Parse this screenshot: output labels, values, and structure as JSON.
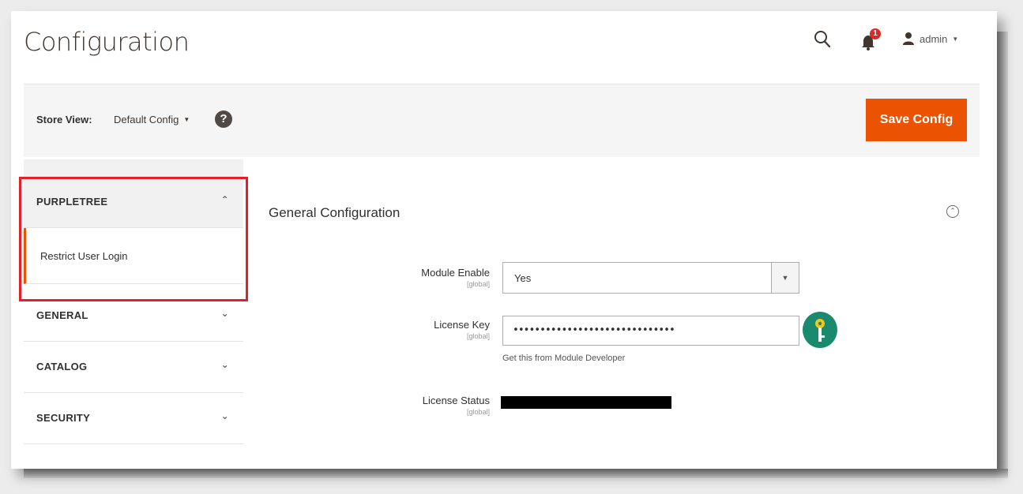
{
  "header": {
    "title": "Configuration",
    "notification_count": "1",
    "user_name": "admin"
  },
  "store_bar": {
    "label": "Store View:",
    "selected": "Default Config",
    "help": "?",
    "save_label": "Save Config"
  },
  "sidebar": {
    "active_tab": {
      "label": "PURPLETREE",
      "items": [
        {
          "label": "Restrict User Login"
        }
      ]
    },
    "tabs": [
      {
        "label": "GENERAL"
      },
      {
        "label": "CATALOG"
      },
      {
        "label": "SECURITY"
      }
    ]
  },
  "main": {
    "section_title": "General Configuration",
    "fields": {
      "module_enable": {
        "label": "Module Enable",
        "scope": "[global]",
        "value": "Yes"
      },
      "license_key": {
        "label": "License Key",
        "scope": "[global]",
        "value": "••••••••••••••••••••••••••••••",
        "note": "Get this from Module Developer"
      },
      "license_status": {
        "label": "License Status",
        "scope": "[global]"
      }
    }
  },
  "colors": {
    "accent": "#eb5202",
    "highlight": "#e2202a",
    "key_icon": "#1a8a6e"
  }
}
